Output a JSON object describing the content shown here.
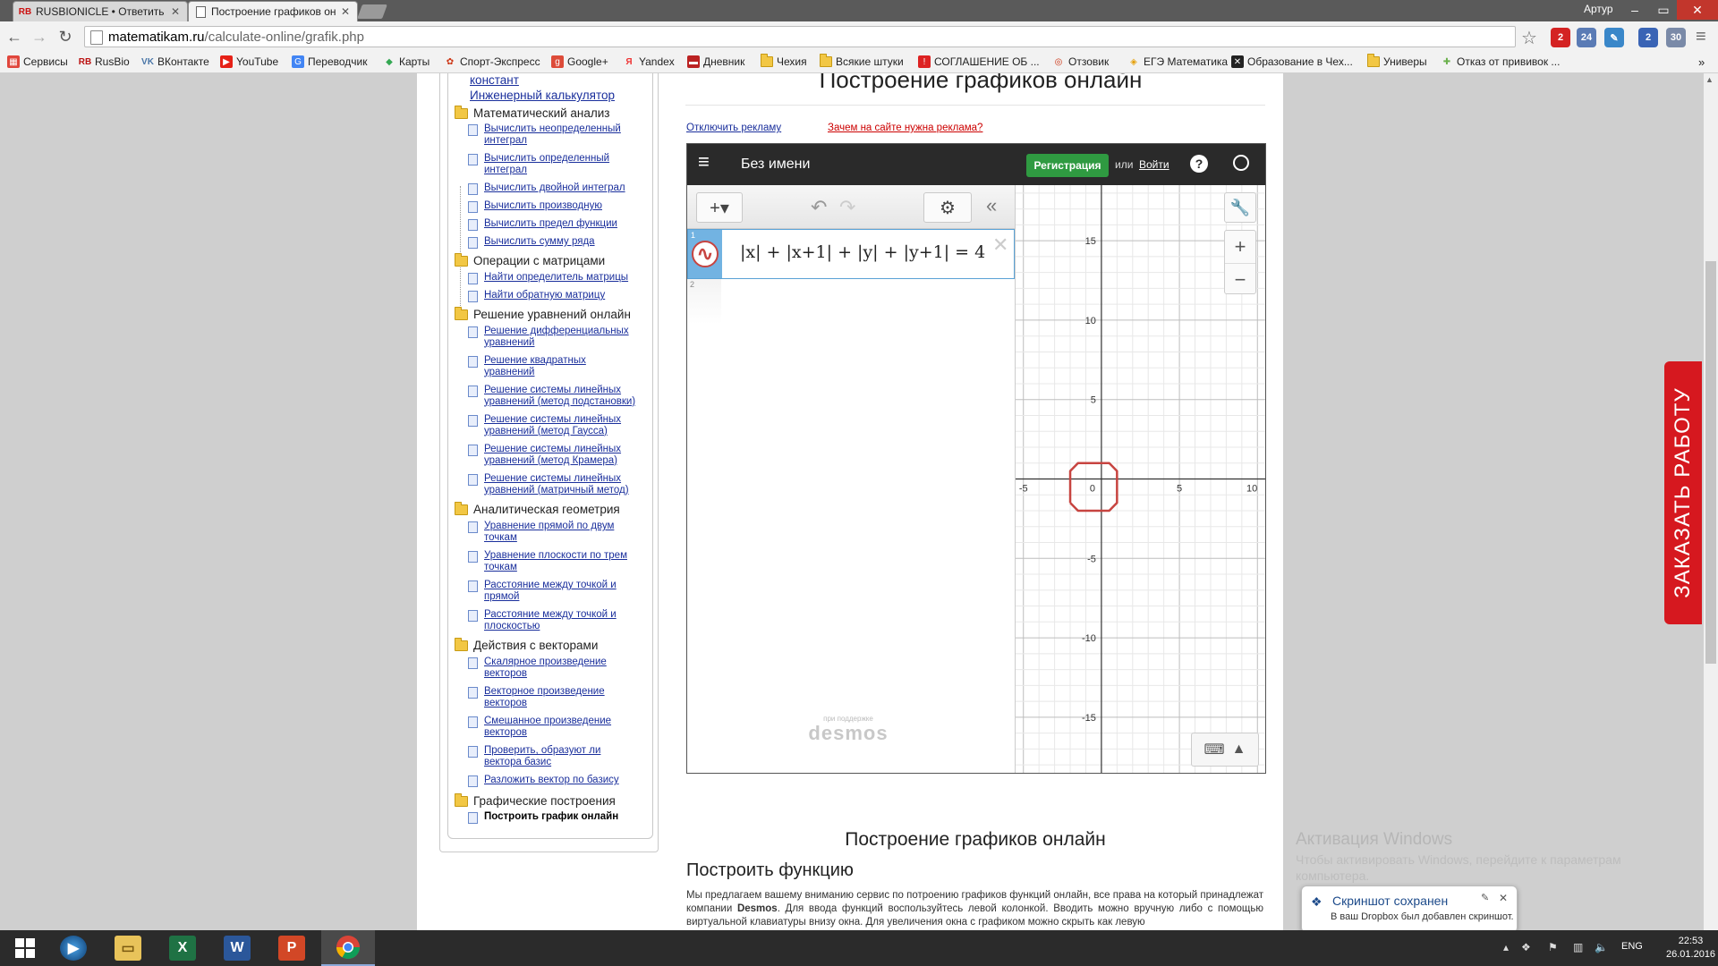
{
  "browser": {
    "tabs": [
      {
        "title": "RUSBIONICLE • Ответить",
        "favicon": "RB"
      },
      {
        "title": "Построение графиков он",
        "favicon": "doc-icon"
      }
    ],
    "user": "Артур",
    "url_host": "matematikam.ru",
    "url_path": "/calculate-online/grafik.php",
    "extensions": [
      {
        "name": "opera-icon",
        "badge": "2",
        "color": "#d42323"
      },
      {
        "name": "cloud-icon",
        "badge": "24",
        "color": "#5a7bb5"
      },
      {
        "name": "feather-icon",
        "badge": "",
        "color": "#3a87c9"
      },
      {
        "name": "b-icon",
        "badge": "2",
        "color": "#3a64b5"
      },
      {
        "name": "mail-icon",
        "badge": "30",
        "color": "#7a8aa8"
      }
    ]
  },
  "bookmarks": [
    {
      "label": "Сервисы",
      "icon": "apps-icon",
      "color": "#e0463c"
    },
    {
      "label": "RusBio",
      "icon": "rb-icon",
      "color": "#b11"
    },
    {
      "label": "ВКонтакте",
      "icon": "vk-icon",
      "color": "#4a76a8"
    },
    {
      "label": "YouTube",
      "icon": "youtube-icon",
      "color": "#e62117"
    },
    {
      "label": "Переводчик",
      "icon": "translate-icon",
      "color": "#4285f4"
    },
    {
      "label": "Карты",
      "icon": "maps-icon",
      "color": "#34a853"
    },
    {
      "label": "Спорт-Экспресс",
      "icon": "sport-icon",
      "color": "#c31"
    },
    {
      "label": "Google+",
      "icon": "gplus-icon",
      "color": "#dd4b39"
    },
    {
      "label": "Yandex",
      "icon": "yandex-icon",
      "color": "#e33"
    },
    {
      "label": "Дневник",
      "icon": "diary-icon",
      "color": "#b22"
    },
    {
      "label": "Чехия",
      "icon": "folder-icon",
      "color": "#f2c744"
    },
    {
      "label": "Всякие штуки",
      "icon": "folder-icon",
      "color": "#f2c744"
    },
    {
      "label": "СОГЛАШЕНИЕ ОБ ...",
      "icon": "alert-icon",
      "color": "#d22"
    },
    {
      "label": "Отзовик",
      "icon": "otzovik-icon",
      "color": "#c31"
    },
    {
      "label": "ЕГЭ Математика",
      "icon": "ege-icon",
      "color": "#e5a00a"
    },
    {
      "label": "Образование в Чех...",
      "icon": "edu-icon",
      "color": "#222"
    },
    {
      "label": "Универы",
      "icon": "folder-icon",
      "color": "#f2c744"
    },
    {
      "label": "Отказ от прививок ...",
      "icon": "syringe-icon",
      "color": "#6ab04c"
    }
  ],
  "sidebar": {
    "top_partial": "констант",
    "top_link": "Инженерный калькулятор",
    "cats": [
      {
        "title": "Математический анализ",
        "items": [
          "Вычислить неопределенный\nинтеграл",
          "Вычислить определенный\nинтеграл",
          "Вычислить двойной интеграл",
          "Вычислить производную",
          "Вычислить предел функции",
          "Вычислить сумму ряда"
        ]
      },
      {
        "title": "Операции с матрицами",
        "items": [
          "Найти определитель матрицы",
          "Найти обратную матрицу"
        ]
      },
      {
        "title": "Решение уравнений онлайн",
        "items": [
          "Решение дифференциальных\nуравнений",
          "Решение квадратных\nуравнений",
          "Решение системы линейных\nуравнений (метод подстановки)",
          "Решение системы линейных\nуравнений (метод Гаусса)",
          "Решение системы линейных\nуравнений (метод Крамера)",
          "Решение системы линейных\nуравнений (матричный метод)"
        ]
      },
      {
        "title": "Аналитическая геометрия",
        "items": [
          "Уравнение прямой по двум\nточкам",
          "Уравнение плоскости по трем\nточкам",
          "Расстояние между точкой и\nпрямой",
          "Расстояние между точкой и\nплоскостью"
        ]
      },
      {
        "title": "Действия с векторами",
        "items": [
          "Скалярное произведение\nвекторов",
          "Векторное произведение\nвекторов",
          "Смешанное произведение\nвекторов",
          "Проверить, образуют ли\nвектора базис",
          "Разложить вектор по базису"
        ]
      },
      {
        "title": "Графические построения",
        "items": [
          "Построить график онлайн"
        ]
      }
    ]
  },
  "main": {
    "heading": "Построение графиков онлайн",
    "ad_off": "Отключить рекламу",
    "ad_why": "Зачем на сайте нужна реклама?",
    "below_heading": "Построение графиков онлайн",
    "subheading": "Построить функцию",
    "description_pre": "Мы предлагаем вашему вниманию сервис по потроению графиков функций онлайн, все права на который принадлежат компании ",
    "description_brand": "Desmos",
    "description_post": ". Для ввода функций воспользуйтесь левой колонкой. Вводить можно вручную либо с помощью виртуальной клавиатуры внизу окна. Для увеличения окна с графиком можно скрыть как левую"
  },
  "desmos": {
    "title": "Без имени",
    "register": "Регистрация",
    "or": "или",
    "login": "Войти",
    "help": "?",
    "expr1_num": "1",
    "expr2_num": "2",
    "formula": "|x| + |x+1| + |y| + |y+1| = 4",
    "powered": "при поддержке",
    "logo": "desmos",
    "graph_color": "#c74440"
  },
  "chart_data": {
    "type": "line",
    "title": "",
    "equation": "|x| + |x+1| + |y| + |y+1| = 4",
    "xlim": [
      -5.5,
      10.5
    ],
    "ylim": [
      -18.5,
      18.5
    ],
    "x_ticks": [
      -5,
      0,
      5,
      10
    ],
    "y_ticks": [
      15,
      10,
      5,
      -5,
      -10,
      -15
    ],
    "grid": true,
    "series": [
      {
        "color": "#c74440",
        "points": [
          [
            -2,
            -1.5
          ],
          [
            -2,
            0.5
          ],
          [
            -1.5,
            1
          ],
          [
            0.5,
            1
          ],
          [
            1,
            0.5
          ],
          [
            1,
            -1.5
          ],
          [
            0.5,
            -2
          ],
          [
            -1.5,
            -2
          ],
          [
            -2,
            -1.5
          ]
        ]
      }
    ]
  },
  "order_work": "ЗАКАЗАТЬ РАБОТУ",
  "windows_activation": {
    "title": "Активация Windows",
    "text": "Чтобы активировать Windows, перейдите к параметрам компьютера."
  },
  "toast": {
    "title": "Скриншот сохранен",
    "body": "В ваш Dropbox был добавлен скриншот."
  },
  "taskbar": {
    "apps": [
      "windows-start-icon",
      "media-player-icon",
      "file-explorer-icon",
      "excel-icon",
      "word-icon",
      "powerpoint-icon",
      "chrome-icon"
    ],
    "lang": "ENG",
    "time": "22:53",
    "date": "26.01.2016"
  }
}
